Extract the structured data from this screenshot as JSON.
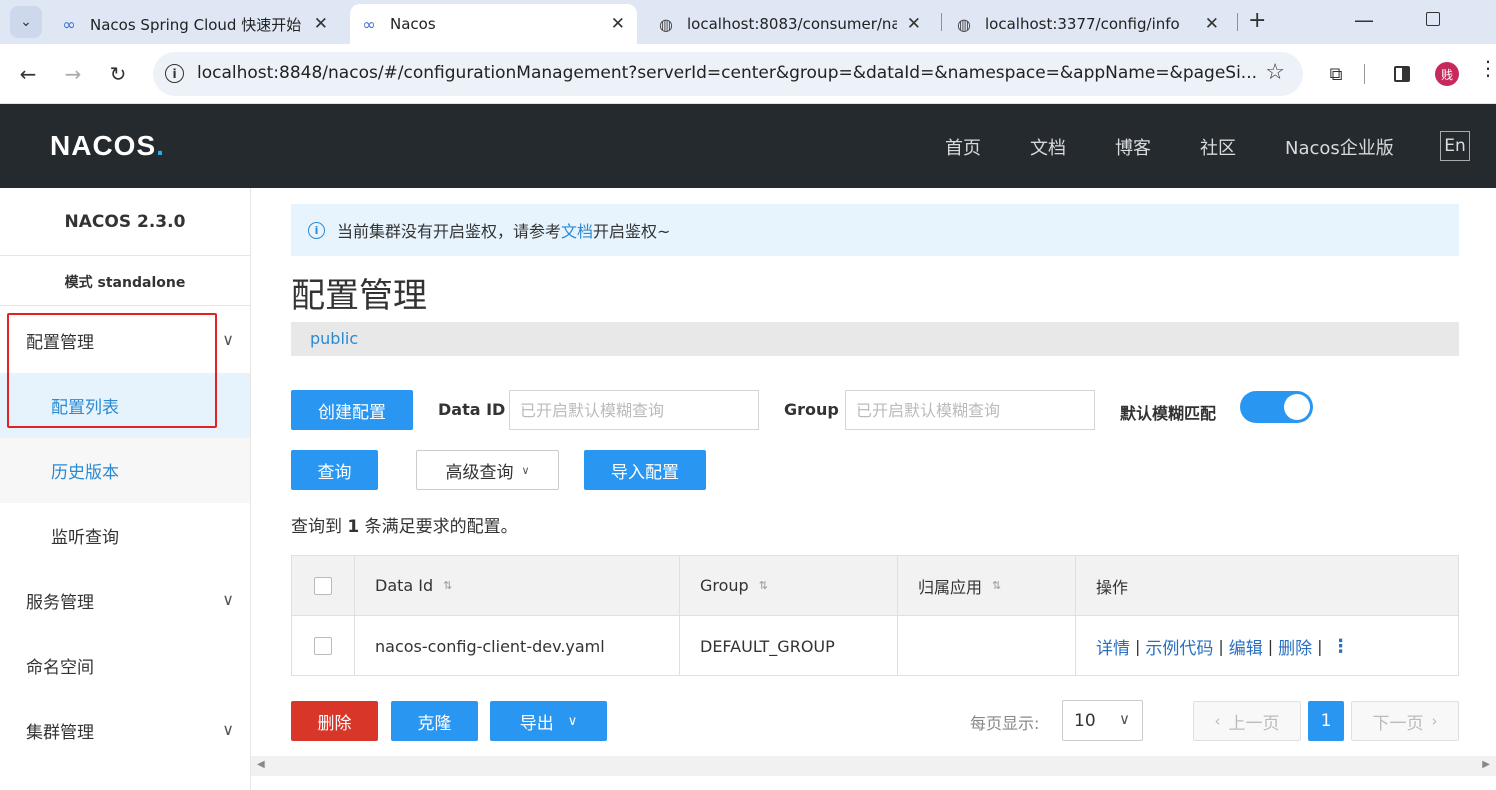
{
  "browser": {
    "tabs": [
      {
        "title": "Nacos Spring Cloud 快速开始",
        "icon": "nacos-infinity-icon"
      },
      {
        "title": "Nacos",
        "icon": "nacos-infinity-icon",
        "active": true
      },
      {
        "title": "localhost:8083/consumer/na",
        "icon": "globe-icon"
      },
      {
        "title": "localhost:3377/config/info",
        "icon": "globe-icon"
      }
    ],
    "url": "localhost:8848/nacos/#/configurationManagement?serverId=center&group=&dataId=&namespace=&appName=&pageSi...",
    "profile_initial": "贱"
  },
  "header": {
    "logo_text": "NACOS",
    "nav": [
      "首页",
      "文档",
      "博客",
      "社区",
      "Nacos企业版"
    ],
    "lang_button": "En"
  },
  "sidebar": {
    "version": "NACOS 2.3.0",
    "mode": "模式 standalone",
    "items": [
      {
        "label": "配置管理",
        "expandable": true
      },
      {
        "label": "配置列表",
        "sub": true,
        "active": true
      },
      {
        "label": "历史版本",
        "sub": true
      },
      {
        "label": "监听查询",
        "sub": true
      },
      {
        "label": "服务管理",
        "expandable": true
      },
      {
        "label": "命名空间"
      },
      {
        "label": "集群管理",
        "expandable": true
      }
    ]
  },
  "alert": {
    "prefix": "当前集群没有开启鉴权，请参考",
    "link": "文档",
    "suffix": "开启鉴权~"
  },
  "page_title": "配置管理",
  "namespace": "public",
  "search": {
    "create_button": "创建配置",
    "data_id_label": "Data ID",
    "data_id_placeholder": "已开启默认模糊查询",
    "group_label": "Group",
    "group_placeholder": "已开启默认模糊查询",
    "fuzzy_label": "默认模糊匹配",
    "fuzzy_on": true,
    "query_button": "查询",
    "advanced_button": "高级查询",
    "import_button": "导入配置"
  },
  "result": {
    "prefix": "查询到",
    "count": "1",
    "suffix": "条满足要求的配置。"
  },
  "table": {
    "columns": [
      "Data Id",
      "Group",
      "归属应用",
      "操作"
    ],
    "rows": [
      {
        "data_id": "nacos-config-client-dev.yaml",
        "group": "DEFAULT_GROUP",
        "app": "",
        "ops": [
          "详情",
          "示例代码",
          "编辑",
          "删除"
        ]
      }
    ]
  },
  "footer": {
    "delete_button": "删除",
    "clone_button": "克隆",
    "export_button": "导出",
    "per_page_label": "每页显示:",
    "per_page_value": "10",
    "prev_button": "上一页",
    "current_page": "1",
    "next_button": "下一页"
  },
  "colors": {
    "primary": "#2997f2",
    "danger": "#d9362a",
    "header_bg": "#252a2f",
    "highlight_box": "#e02222"
  }
}
